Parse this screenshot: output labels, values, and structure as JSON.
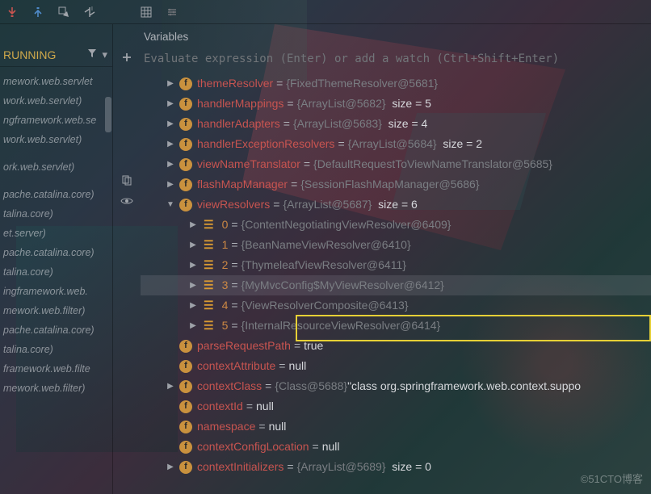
{
  "panel_title": "Variables",
  "eval_placeholder": "Evaluate expression (Enter) or add a watch (Ctrl+Shift+Enter)",
  "left": {
    "title": "RUNNING",
    "threads": [
      "mework.web.servlet",
      "work.web.servlet)",
      "ngframework.web.se",
      "work.web.servlet)",
      "",
      "ork.web.servlet)",
      "",
      "pache.catalina.core)",
      "talina.core)",
      "et.server)",
      "pache.catalina.core)",
      "talina.core)",
      "ingframework.web.",
      "mework.web.filter)",
      "pache.catalina.core)",
      "talina.core)",
      "framework.web.filte",
      "mework.web.filter)",
      ""
    ]
  },
  "tree": {
    "fields": [
      {
        "name": "themeResolver",
        "val": "{FixedThemeResolver@5681}",
        "size": null
      },
      {
        "name": "handlerMappings",
        "val": "{ArrayList@5682}",
        "size": "size = 5"
      },
      {
        "name": "handlerAdapters",
        "val": "{ArrayList@5683}",
        "size": "size = 4"
      },
      {
        "name": "handlerExceptionResolvers",
        "val": "{ArrayList@5684}",
        "size": "size = 2"
      },
      {
        "name": "viewNameTranslator",
        "val": "{DefaultRequestToViewNameTranslator@5685}",
        "size": null
      },
      {
        "name": "flashMapManager",
        "val": "{SessionFlashMapManager@5686}",
        "size": null
      }
    ],
    "viewResolvers": {
      "name": "viewResolvers",
      "val": "{ArrayList@5687}",
      "size": "size = 6",
      "items": [
        {
          "idx": "0",
          "val": "{ContentNegotiatingViewResolver@6409}"
        },
        {
          "idx": "1",
          "val": "{BeanNameViewResolver@6410}"
        },
        {
          "idx": "2",
          "val": "{ThymeleafViewResolver@6411}"
        },
        {
          "idx": "3",
          "val": "{MyMvcConfig$MyViewResolver@6412}"
        },
        {
          "idx": "4",
          "val": "{ViewResolverComposite@6413}"
        },
        {
          "idx": "5",
          "val": "{InternalResourceViewResolver@6414}"
        }
      ]
    },
    "tail": [
      {
        "name": "parseRequestPath",
        "wht": "true"
      },
      {
        "name": "contextAttribute",
        "wht": "null"
      },
      {
        "name": "contextClass",
        "gval": "{Class@5688}",
        "wht": " \"class org.springframework.web.context.suppo"
      },
      {
        "name": "contextId",
        "wht": "null"
      },
      {
        "name": "namespace",
        "wht": "null"
      },
      {
        "name": "contextConfigLocation",
        "wht": "null"
      },
      {
        "name": "contextInitializers",
        "gval": "{ArrayList@5689}",
        "size": "size = 0"
      }
    ]
  },
  "watermark": "©51CTO博客"
}
